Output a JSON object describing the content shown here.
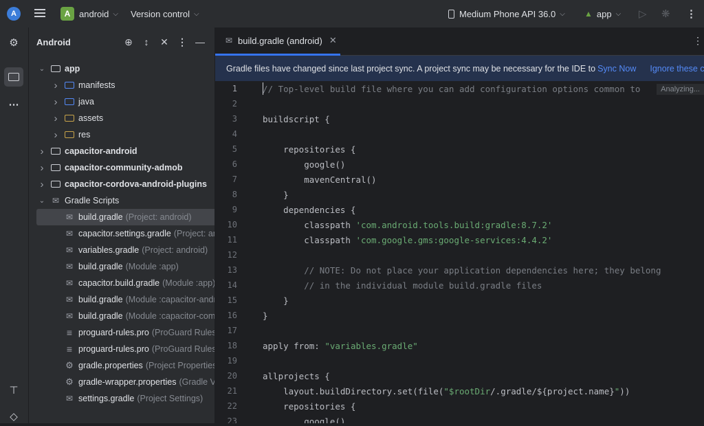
{
  "titlebar": {
    "logo": "A",
    "project_badge": "A",
    "project_name": "android",
    "vcs_label": "Version control",
    "device_label": "Medium Phone API 36.0",
    "run_config": "app"
  },
  "toolstrip": {
    "items": [
      "structure-icon",
      "folder-icon",
      "more-icon",
      "build-icon",
      "gem-icon"
    ]
  },
  "panel": {
    "title": "Android",
    "tree": [
      {
        "label": "app",
        "hint": "",
        "arrow": "down",
        "icon": "module",
        "bold": true
      },
      {
        "label": "manifests",
        "hint": "",
        "arrow": "right",
        "icon": "folder-blue",
        "bold": false
      },
      {
        "label": "java",
        "hint": "",
        "arrow": "right",
        "icon": "folder-blue",
        "bold": false
      },
      {
        "label": "assets",
        "hint": "",
        "arrow": "right",
        "icon": "folder-res",
        "bold": false
      },
      {
        "label": "res",
        "hint": "",
        "arrow": "right",
        "icon": "folder-res",
        "bold": false
      },
      {
        "label": "capacitor-android",
        "hint": "",
        "arrow": "right",
        "icon": "module",
        "bold": true
      },
      {
        "label": "capacitor-community-admob",
        "hint": "",
        "arrow": "right",
        "icon": "module",
        "bold": true
      },
      {
        "label": "capacitor-cordova-android-plugins",
        "hint": "",
        "arrow": "right",
        "icon": "module",
        "bold": true
      },
      {
        "label": "Gradle Scripts",
        "hint": "",
        "arrow": "down",
        "icon": "gradle",
        "bold": false
      },
      {
        "label": "build.gradle",
        "hint": "(Project: android)",
        "arrow": "",
        "icon": "gradle",
        "bold": false,
        "selected": true
      },
      {
        "label": "capacitor.settings.gradle",
        "hint": "(Project: and",
        "arrow": "",
        "icon": "gradle",
        "bold": false
      },
      {
        "label": "variables.gradle",
        "hint": "(Project: android)",
        "arrow": "",
        "icon": "gradle",
        "bold": false
      },
      {
        "label": "build.gradle",
        "hint": "(Module :app)",
        "arrow": "",
        "icon": "gradle",
        "bold": false
      },
      {
        "label": "capacitor.build.gradle",
        "hint": "(Module :app)",
        "arrow": "",
        "icon": "gradle",
        "bold": false
      },
      {
        "label": "build.gradle",
        "hint": "(Module :capacitor-andro",
        "arrow": "",
        "icon": "gradle",
        "bold": false
      },
      {
        "label": "build.gradle",
        "hint": "(Module :capacitor-comm",
        "arrow": "",
        "icon": "gradle",
        "bold": false
      },
      {
        "label": "proguard-rules.pro",
        "hint": "(ProGuard Rules fo",
        "arrow": "",
        "icon": "text",
        "bold": false
      },
      {
        "label": "proguard-rules.pro",
        "hint": "(ProGuard Rules fc",
        "arrow": "",
        "icon": "text",
        "bold": false
      },
      {
        "label": "gradle.properties",
        "hint": "(Project Properties)",
        "arrow": "",
        "icon": "gear",
        "bold": false
      },
      {
        "label": "gradle-wrapper.properties",
        "hint": "(Gradle Ve",
        "arrow": "",
        "icon": "gear",
        "bold": false
      },
      {
        "label": "settings.gradle",
        "hint": "(Project Settings)",
        "arrow": "",
        "icon": "gradle",
        "bold": false
      }
    ]
  },
  "editor": {
    "tab_label": "build.gradle (android)",
    "banner_message": "Gradle files have changed since last project sync. A project sync may be necessary for the IDE to",
    "banner_sync": "Sync Now",
    "banner_ignore": "Ignore these changes",
    "analyzing": "Analyzing...",
    "lines": [
      {
        "n": "1",
        "segs": [
          {
            "t": "// Top-level build file where you can add configuration options common to",
            "c": "comment"
          }
        ]
      },
      {
        "n": "2",
        "segs": []
      },
      {
        "n": "3",
        "segs": [
          {
            "t": "buildscript {",
            "c": ""
          }
        ]
      },
      {
        "n": "4",
        "segs": []
      },
      {
        "n": "5",
        "segs": [
          {
            "t": "    repositories {",
            "c": ""
          }
        ]
      },
      {
        "n": "6",
        "segs": [
          {
            "t": "        google()",
            "c": ""
          }
        ]
      },
      {
        "n": "7",
        "segs": [
          {
            "t": "        mavenCentral()",
            "c": ""
          }
        ]
      },
      {
        "n": "8",
        "segs": [
          {
            "t": "    }",
            "c": ""
          }
        ]
      },
      {
        "n": "9",
        "segs": [
          {
            "t": "    dependencies {",
            "c": ""
          }
        ]
      },
      {
        "n": "10",
        "segs": [
          {
            "t": "        classpath ",
            "c": ""
          },
          {
            "t": "'com.android.tools.build:gradle:8.7.2'",
            "c": "string"
          }
        ]
      },
      {
        "n": "11",
        "segs": [
          {
            "t": "        classpath ",
            "c": ""
          },
          {
            "t": "'com.google.gms:google-services:4.4.2'",
            "c": "string"
          }
        ]
      },
      {
        "n": "12",
        "segs": []
      },
      {
        "n": "13",
        "segs": [
          {
            "t": "        // NOTE: Do not place your application dependencies here; they belong",
            "c": "comment"
          }
        ]
      },
      {
        "n": "14",
        "segs": [
          {
            "t": "        // in the individual module build.gradle files",
            "c": "comment"
          }
        ]
      },
      {
        "n": "15",
        "segs": [
          {
            "t": "    }",
            "c": ""
          }
        ]
      },
      {
        "n": "16",
        "segs": [
          {
            "t": "}",
            "c": ""
          }
        ]
      },
      {
        "n": "17",
        "segs": []
      },
      {
        "n": "18",
        "segs": [
          {
            "t": "apply from: ",
            "c": ""
          },
          {
            "t": "\"variables.gradle\"",
            "c": "string"
          }
        ]
      },
      {
        "n": "19",
        "segs": []
      },
      {
        "n": "20",
        "segs": [
          {
            "t": "allprojects {",
            "c": ""
          }
        ]
      },
      {
        "n": "21",
        "segs": [
          {
            "t": "    layout.buildDirectory.set(file(",
            "c": ""
          },
          {
            "t": "\"$rootDir",
            "c": "string"
          },
          {
            "t": "/.gradle/",
            "c": ""
          },
          {
            "t": "${project.name}",
            "c": ""
          },
          {
            "t": "\"",
            "c": "string"
          },
          {
            "t": "))",
            "c": ""
          }
        ]
      },
      {
        "n": "22",
        "segs": [
          {
            "t": "    repositories {",
            "c": ""
          }
        ]
      },
      {
        "n": "23",
        "segs": [
          {
            "t": "        google()",
            "c": ""
          }
        ]
      }
    ]
  }
}
